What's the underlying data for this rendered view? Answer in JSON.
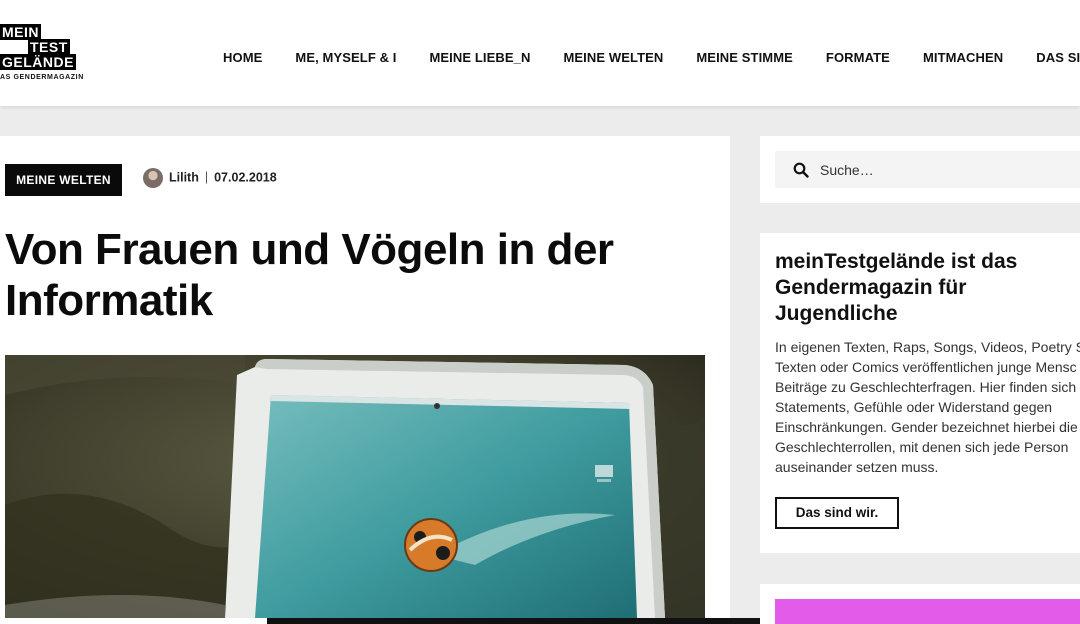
{
  "logo": {
    "line1": "MEIN",
    "line2": "TEST",
    "line3": "GELÄNDE",
    "tagline": "AS GENDERMAGAZIN"
  },
  "nav": {
    "items": [
      "HOME",
      "ME, MYSELF & I",
      "MEINE LIEBE_N",
      "MEINE WELTEN",
      "MEINE STIMME",
      "FORMATE",
      "MITMACHEN",
      "DAS SIN"
    ]
  },
  "article": {
    "category": "MEINE WELTEN",
    "author": "Lilith",
    "separator": "|",
    "date": "07.02.2018",
    "title": "Von Frauen und Vögeln in der Informatik"
  },
  "sidebar": {
    "search_placeholder": "Suche…",
    "about_title": "meinTestgelände ist das Gendermagazin für Jugendliche",
    "about_lines": [
      "In eigenen Texten, Raps, Songs, Videos, Poetry Sla",
      "Texten oder Comics veröffentlichen junge Mensc",
      "Beiträge zu Geschlechterfragen. Hier finden sich",
      "Statements, Gefühle oder Widerstand gegen",
      "Einschränkungen. Gender bezeichnet hierbei die",
      "Geschlechterrollen, mit denen sich jede Person",
      "auseinander setzen muss."
    ],
    "about_button": "Das sind wir."
  },
  "colors": {
    "accent_badge": "#0a0a0a",
    "promo": "#e35ce9",
    "page_bg": "#ececec"
  }
}
